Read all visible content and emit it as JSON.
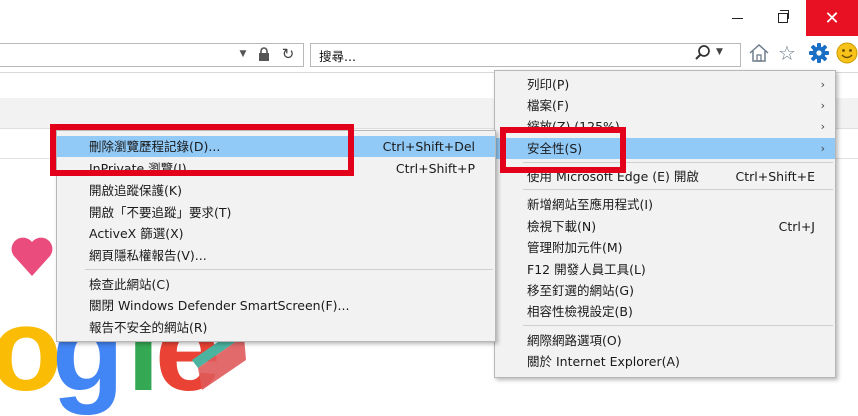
{
  "search": {
    "placeholder": "搜尋..."
  },
  "main_menu": {
    "items": [
      {
        "label": "列印(P)",
        "has_submenu": true
      },
      {
        "label": "檔案(F)",
        "has_submenu": true
      },
      {
        "label": "縮放(Z) (125%)",
        "has_submenu": true
      },
      {
        "label": "安全性(S)",
        "has_submenu": true,
        "highlighted": true
      },
      {
        "label": "使用 Microsoft Edge (E) 開啟",
        "shortcut": "Ctrl+Shift+E"
      },
      {
        "label": "新增網站至應用程式(I)"
      },
      {
        "label": "檢視下載(N)",
        "shortcut": "Ctrl+J"
      },
      {
        "label": "管理附加元件(M)"
      },
      {
        "label": "F12 開發人員工具(L)"
      },
      {
        "label": "移至釘選的網站(G)"
      },
      {
        "label": "相容性檢視設定(B)"
      },
      {
        "label": "網際網路選項(O)"
      },
      {
        "label": "關於 Internet Explorer(A)"
      }
    ]
  },
  "security_submenu": {
    "items": [
      {
        "label": "刪除瀏覽歷程記錄(D)...",
        "shortcut": "Ctrl+Shift+Del",
        "highlighted": true
      },
      {
        "label": "InPrivate 瀏覽(I)",
        "shortcut": "Ctrl+Shift+P"
      },
      {
        "label": "開啟追蹤保護(K)"
      },
      {
        "label": "開啟「不要追蹤」要求(T)"
      },
      {
        "label": "ActiveX 篩選(X)"
      },
      {
        "label": "網頁隱私權報告(V)..."
      },
      {
        "label": "檢查此網站(C)"
      },
      {
        "label": "關閉 Windows Defender SmartScreen(F)..."
      },
      {
        "label": "報告不安全的網站(R)"
      }
    ]
  },
  "colors": {
    "highlight": "#91c9f7",
    "annotation_box": "#e2001a",
    "close_button": "#e81123",
    "toolbar_gear": "#1a6fc4"
  },
  "icons": [
    "minimize-icon",
    "restore-icon",
    "close-icon",
    "lock-icon",
    "refresh-icon",
    "search-icon",
    "home-icon",
    "favorites-star-icon",
    "tools-gear-icon",
    "feedback-smiley-icon"
  ]
}
